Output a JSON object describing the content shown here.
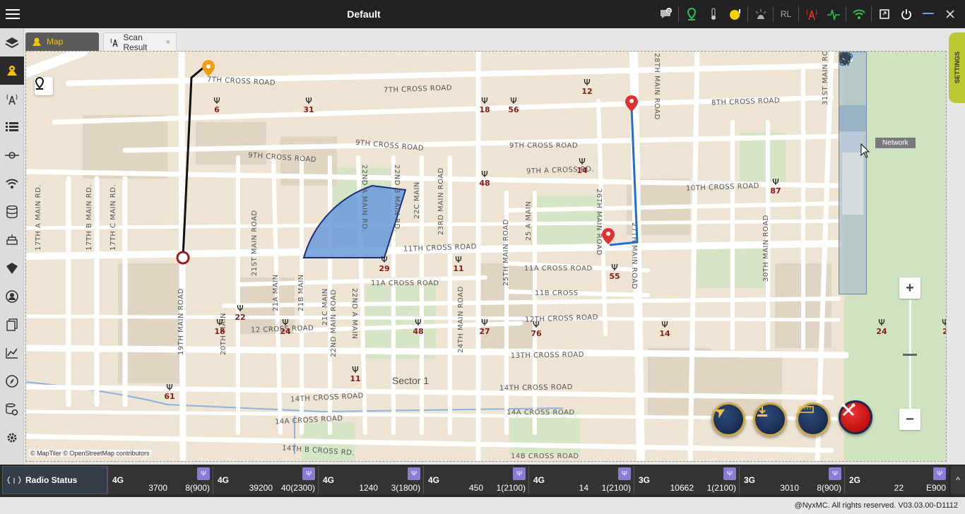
{
  "app": {
    "title": "Default"
  },
  "topbar": {
    "icons": [
      "message-icon",
      "location-pin-icon",
      "thermometer-icon",
      "power-status-icon",
      "alarm-icon",
      "rl-icon",
      "signal-tower-icon",
      "activity-icon",
      "wifi-icon",
      "export-icon",
      "power-icon",
      "minimize-icon",
      "close-icon"
    ],
    "message_badge": "0",
    "rl_label": "RL"
  },
  "sidebar": {
    "items": [
      "layers-icon",
      "map-icon",
      "antenna-icon",
      "list-icon",
      "route-icon",
      "wifi-icon",
      "database-icon",
      "stack-icon",
      "shield-icon",
      "user-icon",
      "documents-icon",
      "chart-icon",
      "compass-icon",
      "settings-list-icon",
      "gear-icon"
    ]
  },
  "tabs": [
    {
      "label": "Map",
      "active": true
    },
    {
      "label": "Scan Result",
      "active": false,
      "close": "×"
    }
  ],
  "map": {
    "roads": [
      "7TH CROSS ROAD",
      "7TH CROSS ROAD",
      "8TH CROSS ROAD",
      "9TH CROSS ROAD",
      "9TH CROSS ROAD",
      "9TH CROSS ROAD",
      "9TH A CROSS RD.",
      "10TH CROSS ROAD",
      "11TH CROSS ROAD",
      "11A CROSS ROAD",
      "11A CROSS ROAD",
      "11B CROSS",
      "12 CROSS ROAD",
      "12TH CROSS ROAD",
      "13TH CROSS ROAD",
      "14TH CROSS ROAD",
      "14TH CROSS ROAD",
      "14A CROSS ROAD",
      "14A CROSS ROAD",
      "14TH B CROSS RD.",
      "14B CROSS ROAD",
      "17TH A MAIN RD.",
      "17TH B MAIN RD.",
      "17TH C MAIN RD.",
      "19TH MAIN ROAD",
      "20TH MAIN",
      "21ST MAIN ROAD",
      "21A MAIN",
      "21B MAIN",
      "21C MAIN",
      "22ND A MAIN RD.",
      "22ND B MAIN RD.",
      "22C MAIN",
      "23RD MAIN ROAD",
      "22ND MAIN ROAD",
      "22ND A MAIN",
      "24TH MAIN ROAD",
      "25TH MAIN ROAD",
      "25 A MAIN",
      "26TH MAIN ROAD",
      "27TH MAIN ROAD",
      "28TH MAIN ROAD",
      "30TH MAIN ROAD",
      "31ST MAIN ROAD"
    ],
    "sites": [
      "6",
      "31",
      "18",
      "56",
      "12",
      "48",
      "14",
      "87",
      "29",
      "11",
      "55",
      "22",
      "18",
      "24",
      "48",
      "27",
      "76",
      "14",
      "24",
      "2",
      "11",
      "61"
    ],
    "sector_label": "Sector 1",
    "attribution": "© MapTiler © OpenStreetMap contributors",
    "tooltip": "Network",
    "zoom_in": "+",
    "zoom_out": "−",
    "zoom_level_fraction": 0.7
  },
  "settings_tab": "SETTINGS",
  "status": {
    "label": "Radio Status",
    "cells": [
      {
        "tech": "4G",
        "value": "3700",
        "band": "8(900)"
      },
      {
        "tech": "4G",
        "value": "39200",
        "band": "40(2300)"
      },
      {
        "tech": "4G",
        "value": "1240",
        "band": "3(1800)"
      },
      {
        "tech": "4G",
        "value": "450",
        "band": "1(2100)"
      },
      {
        "tech": "4G",
        "value": "14",
        "band": "1(2100)"
      },
      {
        "tech": "3G",
        "value": "10662",
        "band": "1(2100)"
      },
      {
        "tech": "3G",
        "value": "3010",
        "band": "8(900)"
      },
      {
        "tech": "2G",
        "value": "22",
        "band": "E900"
      }
    ]
  },
  "footer": "@NyxMC. All rights reserved. V03.03.00-D1112",
  "colors": {
    "accent": "#f5c400",
    "route_black": "#111111",
    "route_blue": "#1f6fd0",
    "sector_fill": "#6a9ad8",
    "marker_red": "#e03030"
  }
}
